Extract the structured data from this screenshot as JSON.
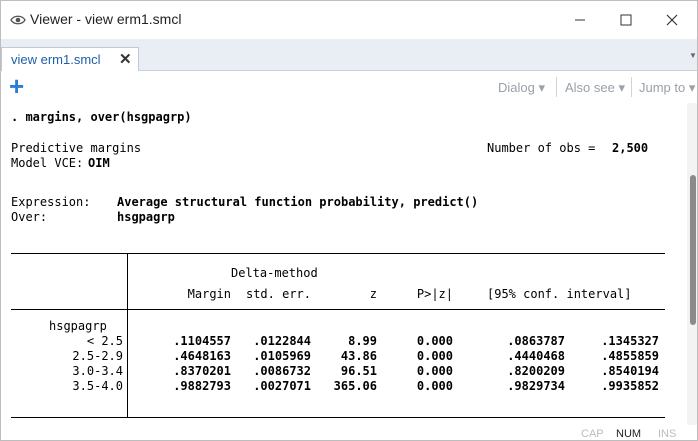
{
  "window": {
    "title": "Viewer - view erm1.smcl"
  },
  "tab": {
    "label": "view erm1.smcl"
  },
  "toolbar": {
    "dialog": "Dialog",
    "also_see": "Also see",
    "jump_to": "Jump to"
  },
  "output": {
    "command": ". margins, over(hsgpagrp)",
    "line_pred": "Predictive margins",
    "nobs_label": "Number of obs =",
    "nobs_value": "2,500",
    "vce_label": "Model VCE:",
    "vce_value": "OIM",
    "expr_label": "Expression:",
    "expr_value": "Average structural function probability, predict()",
    "over_label": "Over:",
    "over_value": "hsgpagrp",
    "delta_header": "Delta-method",
    "columns": [
      "Margin",
      "std. err.",
      "z",
      "P>|z|",
      "[95% conf. interval]"
    ],
    "group_label": "hsgpagrp",
    "rows": [
      {
        "label": "< 2.5",
        "margin": ".1104557",
        "se": ".0122844",
        "z": "8.99",
        "p": "0.000",
        "lo": ".0863787",
        "hi": ".1345327"
      },
      {
        "label": "2.5-2.9",
        "margin": ".4648163",
        "se": ".0105969",
        "z": "43.86",
        "p": "0.000",
        "lo": ".4440468",
        "hi": ".4855859"
      },
      {
        "label": "3.0-3.4",
        "margin": ".8370201",
        "se": ".0086732",
        "z": "96.51",
        "p": "0.000",
        "lo": ".8200209",
        "hi": ".8540194"
      },
      {
        "label": "3.5-4.0",
        "margin": ".9882793",
        "se": ".0027071",
        "z": "365.06",
        "p": "0.000",
        "lo": ".9829734",
        "hi": ".9935852"
      }
    ]
  },
  "status": {
    "cap": "CAP",
    "num": "NUM",
    "ins": "INS"
  }
}
